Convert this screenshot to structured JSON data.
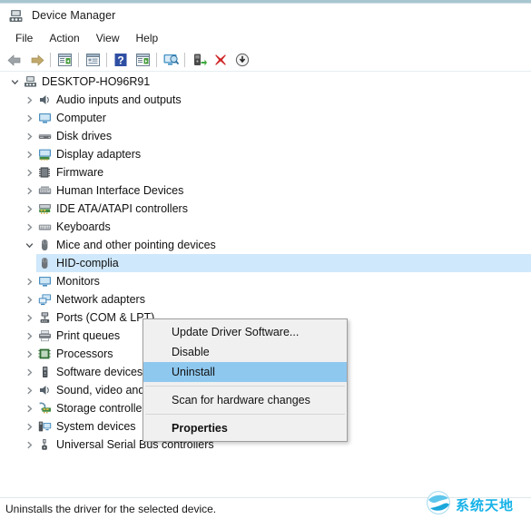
{
  "window": {
    "title": "Device Manager",
    "title_icon": "device-manager-icon",
    "accent_color": "#a8c6d0"
  },
  "menubar": {
    "items": [
      {
        "label": "File",
        "name": "menu-file"
      },
      {
        "label": "Action",
        "name": "menu-action"
      },
      {
        "label": "View",
        "name": "menu-view"
      },
      {
        "label": "Help",
        "name": "menu-help"
      }
    ]
  },
  "toolbar": {
    "buttons": [
      {
        "icon": "back-arrow-icon",
        "name": "toolbar-back"
      },
      {
        "icon": "forward-arrow-icon",
        "name": "toolbar-forward"
      },
      {
        "icon": "show-hide-console-tree-icon",
        "name": "toolbar-console-tree"
      },
      {
        "icon": "properties-icon",
        "name": "toolbar-properties"
      },
      {
        "icon": "help-icon",
        "name": "toolbar-help"
      },
      {
        "icon": "update-driver-icon",
        "name": "toolbar-update-driver"
      },
      {
        "icon": "scan-hardware-changes-icon",
        "name": "toolbar-scan-monitor"
      },
      {
        "icon": "enable-device-icon",
        "name": "toolbar-enable-device"
      },
      {
        "icon": "uninstall-device-icon",
        "name": "toolbar-uninstall"
      },
      {
        "icon": "download-icon",
        "name": "toolbar-download"
      }
    ]
  },
  "tree": {
    "root": {
      "label": "DESKTOP-HO96R91",
      "icon": "computer-root-icon",
      "expanded": true
    },
    "items": [
      {
        "label": "Audio inputs and outputs",
        "icon": "speaker-icon",
        "expanded": false,
        "depth": 1
      },
      {
        "label": "Computer",
        "icon": "monitor-icon",
        "expanded": false,
        "depth": 1
      },
      {
        "label": "Disk drives",
        "icon": "disk-drive-icon",
        "expanded": false,
        "depth": 1
      },
      {
        "label": "Display adapters",
        "icon": "display-adapter-icon",
        "expanded": false,
        "depth": 1
      },
      {
        "label": "Firmware",
        "icon": "chip-icon",
        "expanded": false,
        "depth": 1
      },
      {
        "label": "Human Interface Devices",
        "icon": "hid-icon",
        "expanded": false,
        "depth": 1
      },
      {
        "label": "IDE ATA/ATAPI controllers",
        "icon": "ide-controller-icon",
        "expanded": false,
        "depth": 1
      },
      {
        "label": "Keyboards",
        "icon": "keyboard-icon",
        "expanded": false,
        "depth": 1
      },
      {
        "label": "Mice and other pointing devices",
        "icon": "mouse-icon",
        "expanded": true,
        "depth": 1
      },
      {
        "label": "HID-complia",
        "icon": "mouse-icon",
        "expanded": null,
        "depth": 2,
        "selected": true
      },
      {
        "label": "Monitors",
        "icon": "monitor-icon",
        "expanded": false,
        "depth": 1
      },
      {
        "label": "Network adapters",
        "icon": "network-adapter-icon",
        "expanded": false,
        "depth": 1
      },
      {
        "label": "Ports (COM & LPT)",
        "icon": "port-icon",
        "expanded": false,
        "depth": 1
      },
      {
        "label": "Print queues",
        "icon": "printer-icon",
        "expanded": false,
        "depth": 1
      },
      {
        "label": "Processors",
        "icon": "processor-icon",
        "expanded": false,
        "depth": 1
      },
      {
        "label": "Software devices",
        "icon": "software-device-icon",
        "expanded": false,
        "depth": 1
      },
      {
        "label": "Sound, video and game controllers",
        "icon": "speaker-icon",
        "expanded": false,
        "depth": 1
      },
      {
        "label": "Storage controllers",
        "icon": "storage-controller-icon",
        "expanded": false,
        "depth": 1
      },
      {
        "label": "System devices",
        "icon": "system-device-icon",
        "expanded": false,
        "depth": 1
      },
      {
        "label": "Universal Serial Bus controllers",
        "icon": "usb-icon",
        "expanded": false,
        "depth": 1
      }
    ]
  },
  "context_menu": {
    "highlight_color": "#8fc8ef",
    "items": [
      {
        "label": "Update Driver Software...",
        "name": "ctx-update-driver",
        "highlighted": false,
        "bold": false
      },
      {
        "label": "Disable",
        "name": "ctx-disable",
        "highlighted": false,
        "bold": false
      },
      {
        "label": "Uninstall",
        "name": "ctx-uninstall",
        "highlighted": true,
        "bold": false
      },
      {
        "label": "Scan for hardware changes",
        "name": "ctx-scan-hardware",
        "highlighted": false,
        "bold": false
      },
      {
        "label": "Properties",
        "name": "ctx-properties",
        "highlighted": false,
        "bold": true
      }
    ]
  },
  "statusbar": {
    "text": "Uninstalls the driver for the selected device."
  },
  "watermark": {
    "text": "系统天地",
    "icon": "globe-icon",
    "color": "#18b3e8"
  }
}
